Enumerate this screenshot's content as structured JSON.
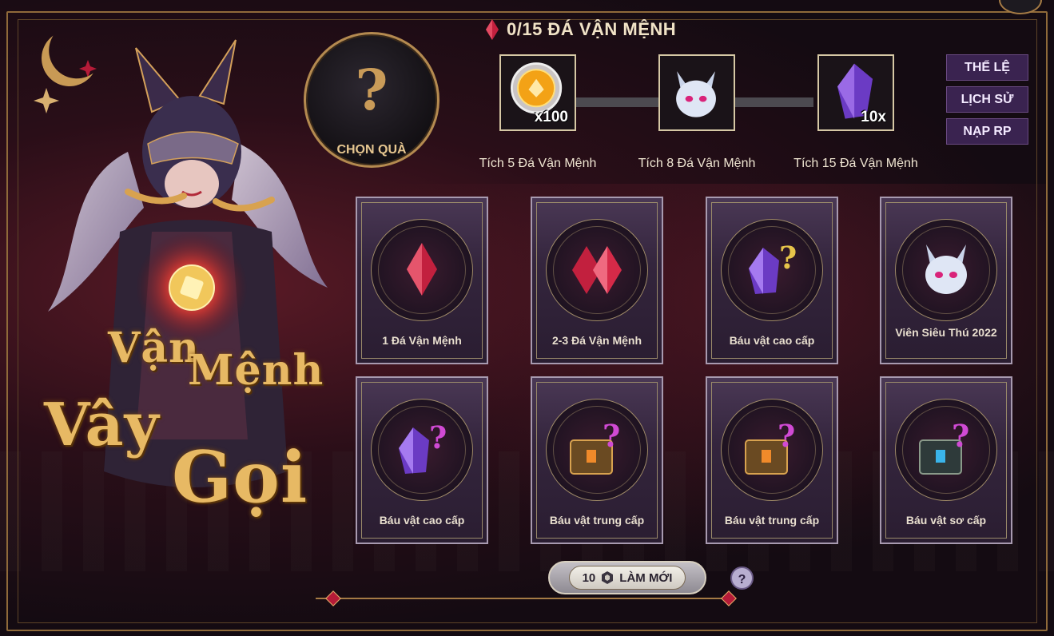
{
  "header": {
    "progress_text": "0/15 ĐÁ VẬN MỆNH"
  },
  "choose_gift": {
    "symbol": "?",
    "label": "CHỌN QUÀ"
  },
  "milestones": [
    {
      "caption": "Tích 5 Đá Vận Mệnh",
      "qty": "x100",
      "icon": "coin-icon"
    },
    {
      "caption": "Tích 8 Đá Vận Mệnh",
      "qty": "",
      "icon": "spirit-fox-icon"
    },
    {
      "caption": "Tích 15 Đá Vận Mệnh",
      "qty": "10x",
      "icon": "purple-crystal-icon"
    }
  ],
  "side_buttons": {
    "rules": "THỂ LỆ",
    "history": "LỊCH SỬ",
    "topup": "NẠP RP"
  },
  "cards": [
    {
      "label": "1 Đá Vận Mệnh",
      "icon": "red-gem-icon"
    },
    {
      "label": "2-3 Đá Vận Mệnh",
      "icon": "double-red-gem-icon"
    },
    {
      "label": "Báu vật cao cấp",
      "icon": "mystery-crystal-icon"
    },
    {
      "label": "Viên Siêu Thú 2022",
      "icon": "spirit-fox-icon"
    },
    {
      "label": "Báu vật cao cấp",
      "icon": "mystery-crystal-icon"
    },
    {
      "label": "Báu vật trung cấp",
      "icon": "mystery-chest-icon"
    },
    {
      "label": "Báu vật trung cấp",
      "icon": "mystery-chest-icon"
    },
    {
      "label": "Báu vật sơ cấp",
      "icon": "mystery-chest-blue-icon"
    }
  ],
  "refresh": {
    "cost": "10",
    "label": "LÀM MỚI"
  },
  "help": {
    "symbol": "?"
  },
  "title_art": {
    "line1": "Vận",
    "line2": "Mệnh",
    "line3": "Vây",
    "line4": "Gọi"
  },
  "colors": {
    "accent_gold": "#c99b58",
    "button_purple": "#3a2350",
    "gem_red": "#b51b38"
  }
}
